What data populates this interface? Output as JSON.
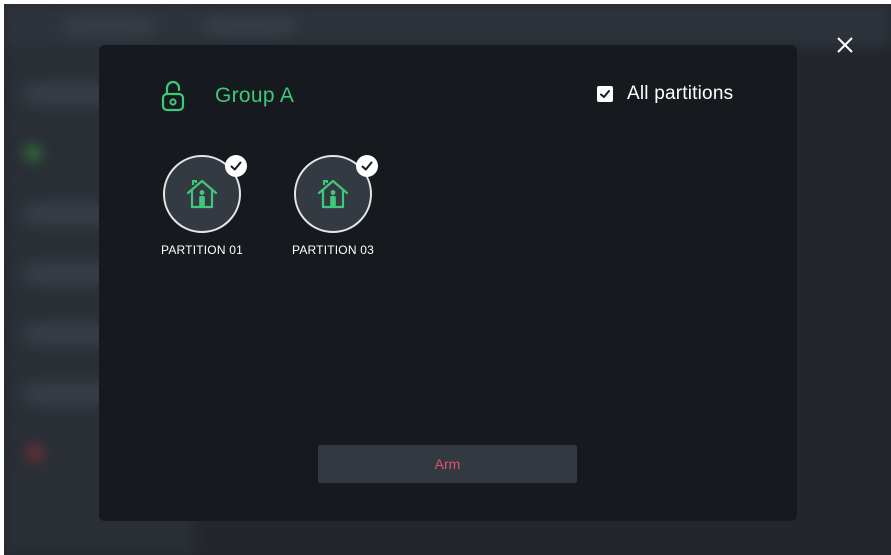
{
  "dialog": {
    "group_title": "Group A",
    "all_partitions_label": "All partitions",
    "all_partitions_checked": true,
    "partitions": [
      {
        "label": "PARTITION 01",
        "selected": true,
        "icon": "house-person-icon"
      },
      {
        "label": "PARTITION 03",
        "selected": true,
        "icon": "house-person-icon"
      }
    ],
    "arm_label": "Arm"
  },
  "icons": {
    "group": "unlocked-padlock-icon",
    "close": "close-icon",
    "check": "checkmark-icon"
  },
  "colors": {
    "accent_green": "#3ec87a",
    "arm_text": "#e0516e",
    "modal_bg": "#16191e"
  }
}
